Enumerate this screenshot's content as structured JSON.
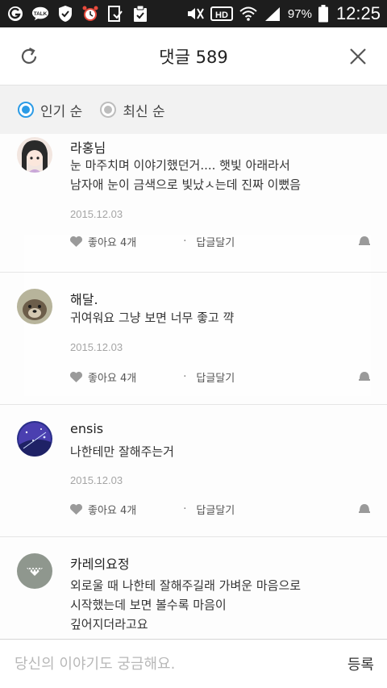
{
  "status_bar": {
    "battery": "97%",
    "time": "12:25",
    "icons": [
      "app-icon",
      "talk-icon",
      "shield-icon",
      "alarm-icon",
      "download-icon",
      "clipboard-icon",
      "mute-icon",
      "hd-icon",
      "wifi-icon",
      "signal-icon",
      "battery-icon"
    ]
  },
  "header": {
    "title": "댓글 589"
  },
  "sort": {
    "options": [
      {
        "label": "인기 순",
        "selected": true
      },
      {
        "label": "최신 순",
        "selected": false
      }
    ]
  },
  "comments": [
    {
      "author": "라홍님",
      "lines": [
        "눈 마주치며 이야기했던거.... 햇빛 아래라서",
        "남자애 눈이 금색으로 빛났ㅅ는데 진짜 이뻤음"
      ],
      "date": "2015.12.03",
      "like_label": "좋아요 4개",
      "reply_label": "답글달기"
    },
    {
      "author": "해달.",
      "lines": [
        "귀여워요 그냥 보면 너무 좋고 꺅"
      ],
      "date": "2015.12.03",
      "like_label": "좋아요 4개",
      "reply_label": "답글달기"
    },
    {
      "author": "ensis",
      "lines": [
        "나한테만 잘해주는거"
      ],
      "date": "2015.12.03",
      "like_label": "좋아요 4개",
      "reply_label": "답글달기"
    },
    {
      "author": "카레의요정",
      "lines": [
        "외로울 때 나한테 잘해주길래 가벼운 마음으로",
        "시작했는데 보면 볼수록 마음이",
        "깊어지더라고요"
      ]
    }
  ],
  "input": {
    "placeholder": "당신의 이야기도 궁금해요.",
    "submit_label": "등록"
  }
}
